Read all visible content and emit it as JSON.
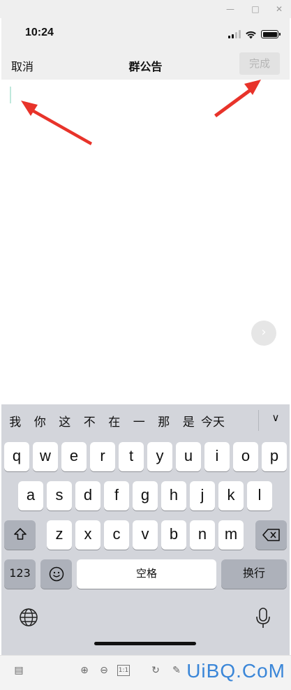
{
  "status": {
    "time": "10:24"
  },
  "nav": {
    "cancel": "取消",
    "title": "群公告",
    "done": "完成"
  },
  "suggestions": [
    "我",
    "你",
    "这",
    "不",
    "在",
    "一",
    "那",
    "是",
    "今天"
  ],
  "keyboard": {
    "row1": [
      "q",
      "w",
      "e",
      "r",
      "t",
      "y",
      "u",
      "i",
      "o",
      "p"
    ],
    "row2": [
      "a",
      "s",
      "d",
      "f",
      "g",
      "h",
      "j",
      "k",
      "l"
    ],
    "row3": [
      "z",
      "x",
      "c",
      "v",
      "b",
      "n",
      "m"
    ],
    "numbers_label": "123",
    "space_label": "空格",
    "return_label": "换行"
  },
  "watermark": "UiBQ.CoM",
  "colors": {
    "accent_arrow": "#e8332a",
    "done_disabled": "#b5b5b5",
    "keyboard_bg": "#d3d5db"
  }
}
